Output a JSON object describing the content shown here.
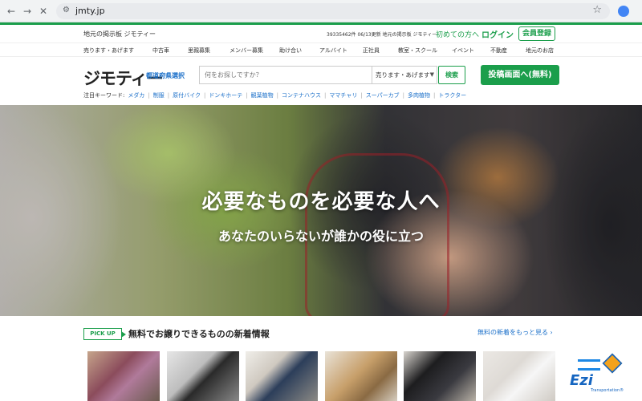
{
  "browser": {
    "back": "←",
    "forward": "→",
    "close": "✕",
    "url": "jmty.jp",
    "star": "☆"
  },
  "header": {
    "tagline": "地元の掲示板 ジモティー",
    "count_text": "39335462件 06/13更新 地元の掲示板 ジモティー",
    "first_time": "初めての方へ",
    "login": "ログイン",
    "register": "会員登録"
  },
  "categories": [
    "売ります・あげます",
    "中古車",
    "里親募集",
    "メンバー募集",
    "助け合い",
    "アルバイト",
    "正社員",
    "教室・スクール",
    "イベント",
    "不動産",
    "地元のお店"
  ],
  "logo": "ジモティー",
  "prefecture_select": "都道府県選択",
  "search": {
    "placeholder": "何をお探しですか？",
    "category_select": "売ります・あげます",
    "button": "検索"
  },
  "post_button": "投稿画面へ(無料)",
  "keywords": {
    "label": "注目キーワード:",
    "items": [
      "メダカ",
      "制服",
      "原付バイク",
      "ドンキホーテ",
      "観葉植物",
      "コンテナハウス",
      "ママチャリ",
      "スーパーカブ",
      "多肉植物",
      "トラクター"
    ]
  },
  "hero": {
    "headline": "必要なものを必要な人へ",
    "subheadline": "あなたのいらないが誰かの役に立つ"
  },
  "pickup": {
    "badge": "PICK UP",
    "title": "無料でお譲りできるものの新着情報",
    "more": "無料の新着をもっと見る ›"
  },
  "watermark": {
    "name": "Ezi",
    "sub": "Transportation®"
  }
}
